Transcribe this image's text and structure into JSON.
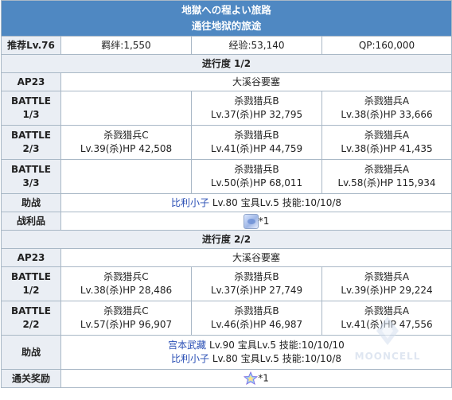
{
  "header": {
    "title_jp": "地獄への程よい旅路",
    "title_cn": "通往地狱的旅途"
  },
  "stats": {
    "level_label": "推荐Lv.76",
    "bond": "羁绊:1,550",
    "exp": "经验:53,140",
    "qp": "QP:160,000"
  },
  "sections": [
    {
      "title": "进行度 1/2",
      "ap_label": "AP23",
      "location": "大溪谷要塞",
      "battles": [
        {
          "label1": "BATTLE",
          "label2": "1/3",
          "enemies": [
            null,
            {
              "name": "杀戮猎兵B",
              "stats": "Lv.37(杀)HP 32,795"
            },
            {
              "name": "杀戮猎兵A",
              "stats": "Lv.38(杀)HP 33,666"
            }
          ]
        },
        {
          "label1": "BATTLE",
          "label2": "2/3",
          "enemies": [
            {
              "name": "杀戮猎兵C",
              "stats": "Lv.39(杀)HP 42,508"
            },
            {
              "name": "杀戮猎兵B",
              "stats": "Lv.41(杀)HP 44,759"
            },
            {
              "name": "杀戮猎兵A",
              "stats": "Lv.38(杀)HP 41,435"
            }
          ]
        },
        {
          "label1": "BATTLE",
          "label2": "3/3",
          "enemies": [
            null,
            {
              "name": "杀戮猎兵B",
              "stats": "Lv.50(杀)HP 68,011"
            },
            {
              "name": "杀戮猎兵A",
              "stats": "Lv.58(杀)HP 115,934"
            }
          ]
        }
      ],
      "support_label": "助战",
      "supports": [
        {
          "name": "比利小子",
          "detail": " Lv.80 宝具Lv.5 技能:10/10/8",
          "link": true
        }
      ],
      "drop_label": "战利品",
      "drop_count": "*1",
      "drop_icon": "item-icon"
    },
    {
      "title": "进行度 2/2",
      "ap_label": "AP23",
      "location": "大溪谷要塞",
      "battles": [
        {
          "label1": "BATTLE",
          "label2": "1/2",
          "enemies": [
            {
              "name": "杀戮猎兵C",
              "stats": "Lv.38(杀)HP 28,486"
            },
            {
              "name": "杀戮猎兵B",
              "stats": "Lv.37(杀)HP 27,749"
            },
            {
              "name": "杀戮猎兵A",
              "stats": "Lv.39(杀)HP 29,224"
            }
          ]
        },
        {
          "label1": "BATTLE",
          "label2": "2/2",
          "enemies": [
            {
              "name": "杀戮猎兵C",
              "stats": "Lv.57(杀)HP 96,907"
            },
            {
              "name": "杀戮猎兵B",
              "stats": "Lv.46(杀)HP 46,987"
            },
            {
              "name": "杀戮猎兵A",
              "stats": "Lv.41(杀)HP 47,556"
            }
          ]
        }
      ],
      "support_label": "助战",
      "supports": [
        {
          "name": "宫本武藏",
          "detail": " Lv.90 宝具Lv.5 技能:10/10/10",
          "link": true
        },
        {
          "name": "比利小子",
          "detail": " Lv.80 宝具Lv.5 技能:10/10/8",
          "link": true
        }
      ],
      "drop_label": "通关奖励",
      "drop_count": "*1",
      "drop_icon": "saint-quartz-icon"
    }
  ],
  "watermark": "MOONCELL",
  "colors": {
    "header_bg": "#4f88c2",
    "label_bg": "#eaeef4",
    "border": "#a9b8c6",
    "link": "#2a4fb5"
  }
}
